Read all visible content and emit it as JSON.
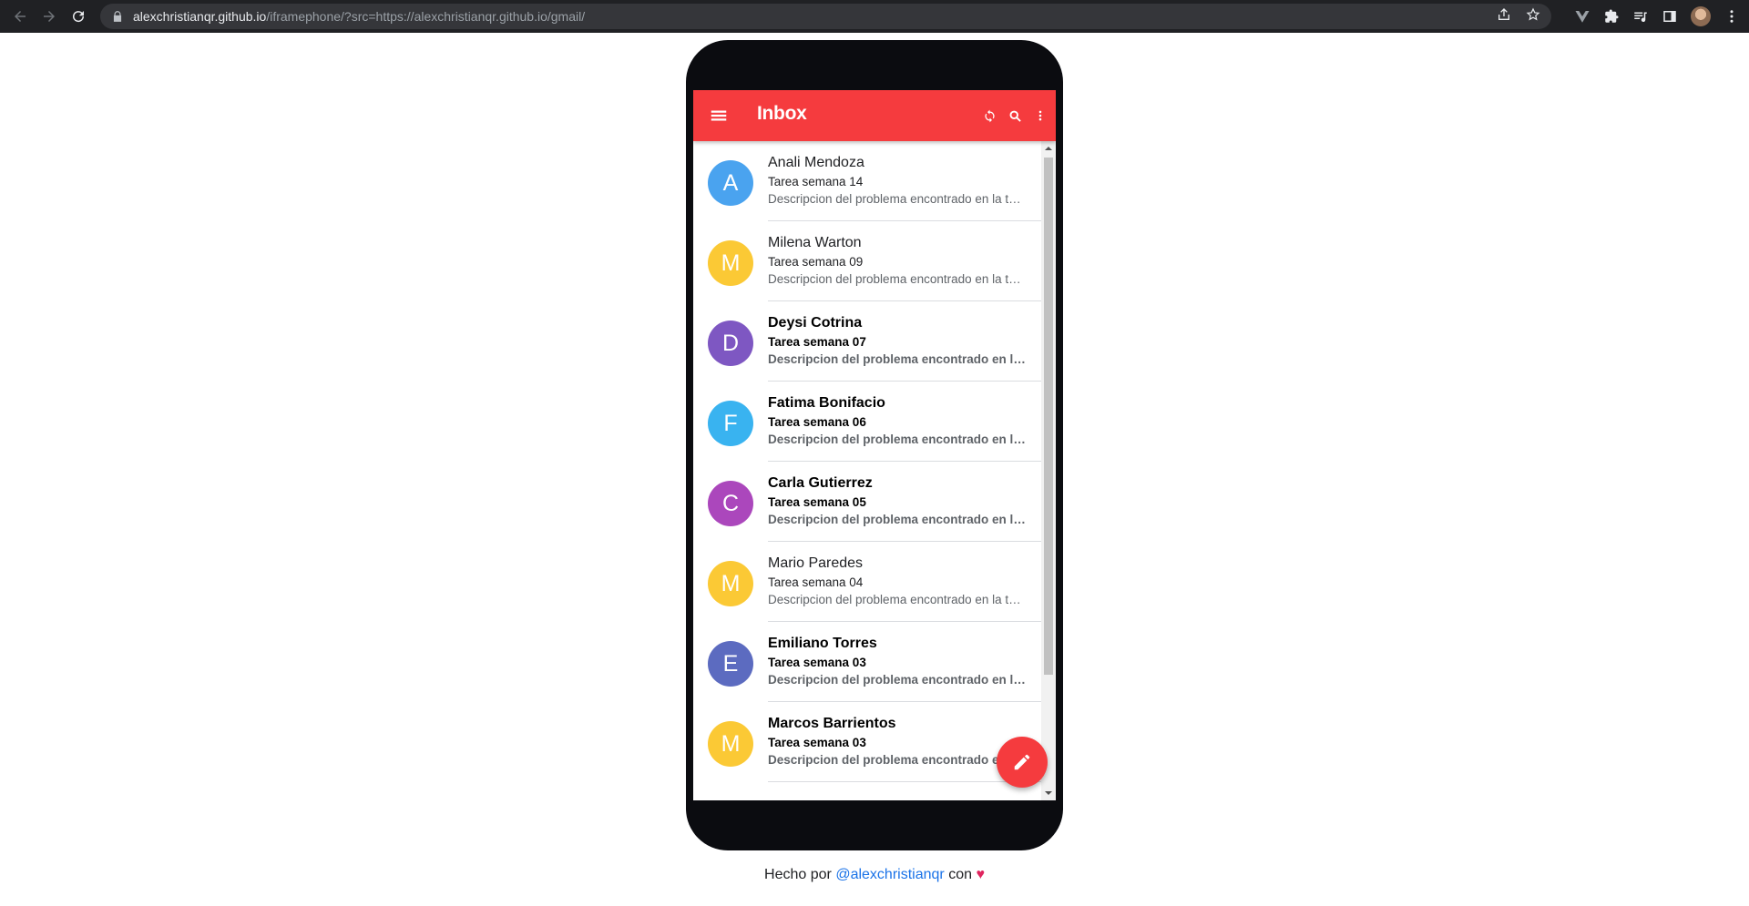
{
  "browser": {
    "url_host": "alexchristianqr.github.io",
    "url_path": "/iframephone/?src=https://alexchristianqr.github.io/gmail/"
  },
  "app": {
    "title": "Inbox",
    "accent_color": "#f53b3e",
    "emails": [
      {
        "initial": "A",
        "avatar_color": "#4aa3ef",
        "sender": "Anali Mendoza",
        "subject": "Tarea semana 14",
        "snippet": "Descripcion del problema encontrado en la tarea",
        "unread": false
      },
      {
        "initial": "M",
        "avatar_color": "#fbc935",
        "sender": "Milena Warton",
        "subject": "Tarea semana 09",
        "snippet": "Descripcion del problema encontrado en la tarea",
        "unread": false
      },
      {
        "initial": "D",
        "avatar_color": "#7e57c2",
        "sender": "Deysi Cotrina",
        "subject": "Tarea semana 07",
        "snippet": "Descripcion del problema encontrado en la tarea",
        "unread": true
      },
      {
        "initial": "F",
        "avatar_color": "#39b3f0",
        "sender": "Fatima Bonifacio",
        "subject": "Tarea semana 06",
        "snippet": "Descripcion del problema encontrado en la tarea",
        "unread": true
      },
      {
        "initial": "C",
        "avatar_color": "#ab47bc",
        "sender": "Carla Gutierrez",
        "subject": "Tarea semana 05",
        "snippet": "Descripcion del problema encontrado en la tarea",
        "unread": true
      },
      {
        "initial": "M",
        "avatar_color": "#fbc935",
        "sender": "Mario Paredes",
        "subject": "Tarea semana 04",
        "snippet": "Descripcion del problema encontrado en la tarea",
        "unread": false
      },
      {
        "initial": "E",
        "avatar_color": "#5c6bc0",
        "sender": "Emiliano Torres",
        "subject": "Tarea semana 03",
        "snippet": "Descripcion del problema encontrado en la tarea",
        "unread": true
      },
      {
        "initial": "M",
        "avatar_color": "#fbc935",
        "sender": "Marcos Barrientos",
        "subject": "Tarea semana 03",
        "snippet": "Descripcion del problema encontrado en la tarea",
        "unread": true
      }
    ]
  },
  "footer": {
    "prefix": "Hecho por",
    "link": "@alexchristianqr",
    "suffix": "con",
    "heart": "♥"
  }
}
